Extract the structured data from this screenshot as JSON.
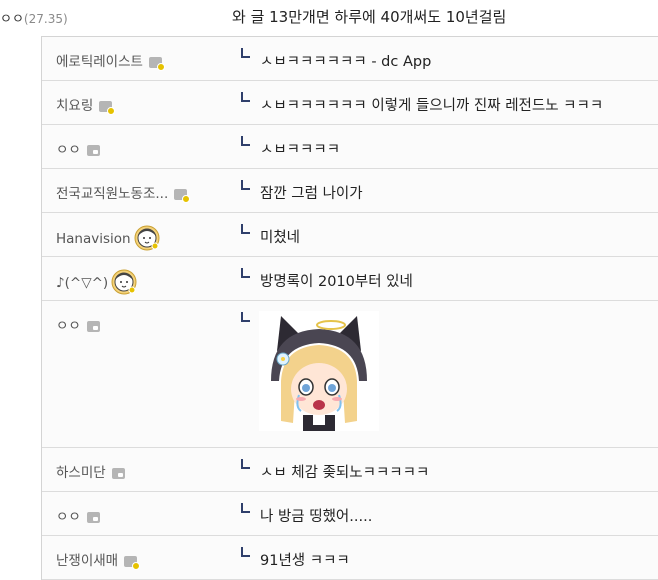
{
  "parent_comment": {
    "nickname": "ㅇㅇ",
    "ip": "(27.35)",
    "text": "와 글 13만개면 하루에 40개써도 10년걸림"
  },
  "replies": [
    {
      "nickname": "에로틱레이스트",
      "text": "ㅅㅂㅋㅋㅋㅋㅋㅋ - dc App",
      "badge": "gold"
    },
    {
      "nickname": "치요링",
      "text": "ㅅㅂㅋㅋㅋㅋㅋㅋ 이렇게 들으니까 진짜 레전드노 ㅋㅋㅋ",
      "badge": "gold"
    },
    {
      "nickname": "ㅇㅇ",
      "text": "ㅅㅂㅋㅋㅋㅋ",
      "badge": "grey"
    },
    {
      "nickname": "전국교직원노동조...",
      "text": "잠깐 그럼 나이가",
      "badge": "gold"
    },
    {
      "nickname": "Hanavision",
      "text": "미쳤네",
      "badge": "avatar"
    },
    {
      "nickname": "♪(^▽^)",
      "text": "방명록이 2010부터 있네",
      "badge": "avatar"
    },
    {
      "nickname": "ㅇㅇ",
      "text": "",
      "badge": "grey",
      "sticker": "anime-girl-cat-hood-sticker"
    },
    {
      "nickname": "하스미단",
      "text": "ㅅㅂ 체감 좆되노ㅋㅋㅋㅋㅋ",
      "badge": "grey"
    },
    {
      "nickname": "ㅇㅇ",
      "text": "나 방금 띵했어.....",
      "badge": "grey"
    },
    {
      "nickname": "난쟁이새매",
      "text": "91년생 ㅋㅋㅋ",
      "badge": "gold"
    }
  ]
}
